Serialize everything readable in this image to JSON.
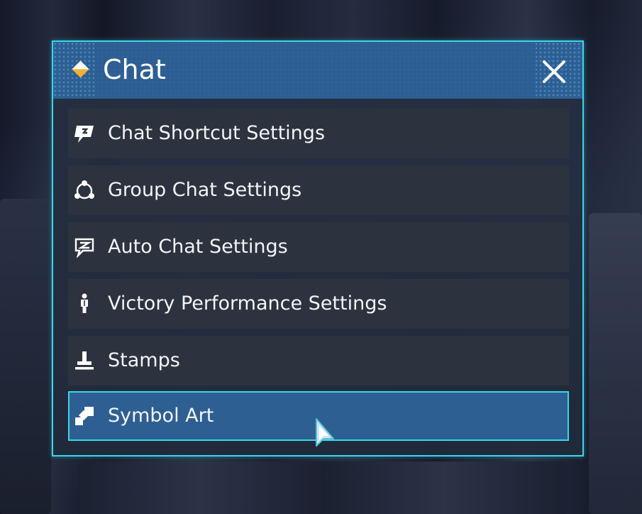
{
  "window": {
    "title": "Chat",
    "close_icon": "close-icon",
    "accent_color": "#38d7ea",
    "title_bar_color": "#2c5f93"
  },
  "menu": {
    "items": [
      {
        "label": "Chat Shortcut Settings",
        "icon": "chat-shortcut-icon",
        "selected": false
      },
      {
        "label": "Group Chat Settings",
        "icon": "group-chat-icon",
        "selected": false
      },
      {
        "label": "Auto Chat Settings",
        "icon": "auto-chat-icon",
        "selected": false
      },
      {
        "label": "Victory Performance Settings",
        "icon": "victory-figure-icon",
        "selected": false
      },
      {
        "label": "Stamps",
        "icon": "stamp-icon",
        "selected": false
      },
      {
        "label": "Symbol Art",
        "icon": "symbol-art-icon",
        "selected": true
      }
    ]
  }
}
